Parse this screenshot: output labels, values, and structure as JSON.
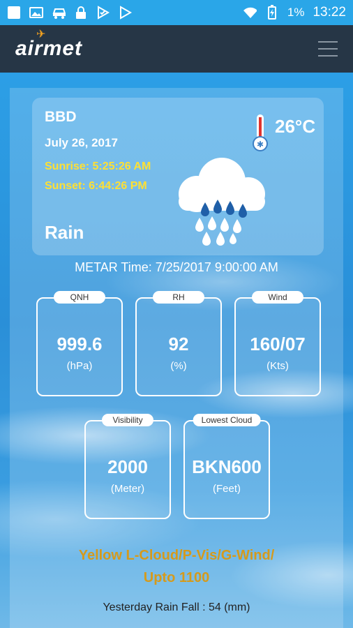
{
  "status_bar": {
    "battery": "1%",
    "time": "13:22"
  },
  "app_bar": {
    "logo_text": "airmet"
  },
  "summary": {
    "station": "BBD",
    "date": "July 26, 2017",
    "sunrise": "Sunrise: 5:25:26 AM",
    "sunset": "Sunset: 6:44:26 PM",
    "condition": "Rain",
    "temperature": "26°C"
  },
  "metar_time": "METAR Time: 7/25/2017 9:00:00 AM",
  "tiles": [
    {
      "label": "QNH",
      "value": "999.6",
      "unit": "(hPa)"
    },
    {
      "label": "RH",
      "value": "92",
      "unit": "(%)"
    },
    {
      "label": "Wind",
      "value": "160/07",
      "unit": "(Kts)"
    },
    {
      "label": "Visibility",
      "value": "2000",
      "unit": "(Meter)"
    },
    {
      "label": "Lowest Cloud",
      "value": "BKN600",
      "unit": "(Feet)"
    }
  ],
  "warning": {
    "line1": "Yellow L-Cloud/P-Vis/G-Wind/",
    "line2": "Upto 1100"
  },
  "rainfall": "Yesterday Rain Fall : 54 (mm)",
  "colors": {
    "app_bar": "#263646",
    "status_bar": "#2aa6e8",
    "sun_text": "#ffe033",
    "warning_text": "#d59a1c"
  }
}
